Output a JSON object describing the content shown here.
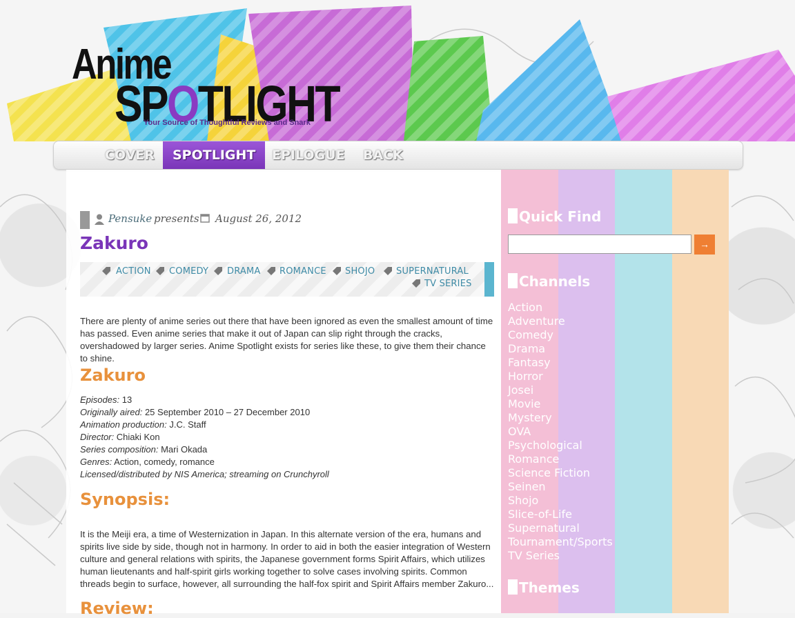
{
  "site": {
    "logo_line1": "Anime",
    "logo_line2_a": "SP",
    "logo_line2_o": "O",
    "logo_line2_b": "TLIGHT",
    "tagline": "Your Source of Thoughtful Reviews and Snark"
  },
  "nav": {
    "items": [
      {
        "label": "COVER"
      },
      {
        "label": "SPOTLIGHT",
        "active": true
      },
      {
        "label": "EPILOGUE"
      },
      {
        "label": "BACK"
      }
    ]
  },
  "post": {
    "author": "Pensuke",
    "presents": "presents",
    "date": "August 26, 2012",
    "title": "Zakuro",
    "tags": [
      "ACTION",
      "COMEDY",
      "DRAMA",
      "ROMANCE",
      "SHOJO",
      "SUPERNATURAL",
      "TV SERIES"
    ],
    "intro": "There are plenty of anime series out there that have been ignored as even the smallest amount of time has passed. Even anime series that make it out of Japan can slip right through the cracks, overshadowed by larger series. Anime Spotlight exists for series like these, to give them their chance to shine.",
    "heading_series": "Zakuro",
    "details": [
      {
        "label": "Episodes:",
        "value": "13"
      },
      {
        "label": "Originally aired:",
        "value": "25 September 2010 – 27 December 2010"
      },
      {
        "label": "Animation production:",
        "value": "J.C. Staff"
      },
      {
        "label": "Director:",
        "value": "Chiaki Kon"
      },
      {
        "label": "Series composition:",
        "value": "Mari Okada"
      },
      {
        "label": "Genres:",
        "value": "Action, comedy, romance"
      }
    ],
    "license": "Licensed/distributed by NIS America; streaming on Crunchyroll",
    "heading_synopsis": "Synopsis:",
    "synopsis": "It is the Meiji era, a time of Westernization in Japan. In this alternate version of the era, humans and spirits live side by side, though not in harmony. In order to aid in both the easier integration of Western culture and general relations with spirits, the Japanese government forms Spirit Affairs, which utilizes human lieutenants and half-spirit girls working together to solve cases involving spirits. Common threads begin to surface, however, all surrounding the half-fox spirit and Spirit Affairs member Zakuro...",
    "heading_review": "Review:"
  },
  "sidebar": {
    "quick_find": "Quick Find",
    "search_placeholder": "",
    "search_button": "→",
    "channels_title": "Channels",
    "channels": [
      "Action",
      "Adventure",
      "Comedy",
      "Drama",
      "Fantasy",
      "Horror",
      "Josei",
      "Movie",
      "Mystery",
      "OVA",
      "Psychological",
      "Romance",
      "Science Fiction",
      "Seinen",
      "Shojo",
      "Slice-of-Life",
      "Supernatural",
      "Tournament/Sports",
      "TV Series"
    ],
    "themes_title": "Themes"
  },
  "colors": {
    "purple": "#7a35b8",
    "orange": "#e8913c",
    "teal": "#3f8ba6",
    "stripe_pink": "#f4bfd6",
    "stripe_lilac": "#dcbfee",
    "stripe_cyan": "#b3e3ea",
    "stripe_peach": "#f8d9b5"
  }
}
